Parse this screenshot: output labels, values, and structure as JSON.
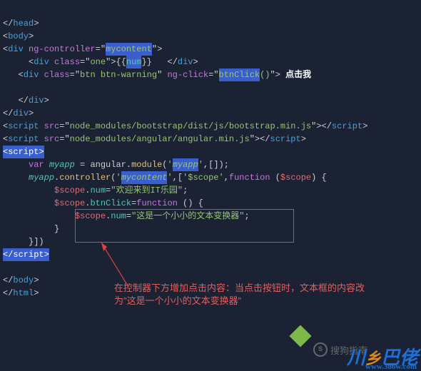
{
  "code": {
    "l1": {
      "close_head": "</",
      "head": "head",
      "gt": ">"
    },
    "l2": {
      "open": "<",
      "body": "body",
      "gt": ">"
    },
    "l3": {
      "open": "<",
      "div": "div",
      "ngctrl": "ng-controller",
      "eq": "=",
      "q": "\"",
      "val": "mycontent",
      "gt": ">"
    },
    "l4": {
      "open": "<",
      "div": "div",
      "class": "class",
      "eq": "=",
      "q": "\"",
      "one": "one",
      "gt": ">",
      "bb1": "{{",
      "num": "num",
      "bb2": "}}",
      "sp": "   ",
      "closeopen": "</",
      "gt2": ">"
    },
    "l5": {
      "open": "<",
      "div": "div",
      "class": "class",
      "eq": "=",
      "q": "\"",
      "btn": "btn btn-warning",
      "ngclick": "ng-click",
      "val": "btnClick",
      "par": "()",
      "gt": ">",
      "txt": " 点击我"
    },
    "l6": "",
    "l7": {
      "closeopen": "</",
      "div": "div",
      "gt": ">"
    },
    "l8": {
      "closeopen": "</",
      "div": "div",
      "gt": ">"
    },
    "l9": {
      "open": "<",
      "script": "script",
      "src": "src",
      "eq": "=",
      "q": "\"",
      "path": "node_modules/bootstrap/dist/js/bootstrap.min.js",
      "gt": ">",
      "close": "</",
      "gt2": ">"
    },
    "l10": {
      "open": "<",
      "script": "script",
      "src": "src",
      "eq": "=",
      "q": "\"",
      "path": "node_modules/angular/angular.min.js",
      "gt": ">",
      "close": "</",
      "gt2": ">"
    },
    "l11": {
      "scripttag": "<script>"
    },
    "l12": {
      "var": "var",
      "myapp": "myapp",
      "eq": " = ",
      "ang": "angular",
      "dot": ".",
      "module": "module",
      "po": "(",
      "q": "'",
      "name": "myapp",
      "comma": ",",
      "arr": "[]",
      "pc": ")",
      "sc": ";"
    },
    "l13": {
      "myapp": "myapp",
      "dot": ".",
      "ctrl": "controller",
      "po": "(",
      "q": "'",
      "name": "mycontent",
      "comma": ",",
      "br": "[",
      "q2": "'",
      "scope": "$scope",
      "comma2": ",",
      "fn": "function",
      "po2": " (",
      "arg": "$scope",
      "pc2": ")",
      "brace": " {"
    },
    "l14": {
      "scope": "$scope",
      "dot": ".",
      "num": "num",
      "eq": "=",
      "q": "\"",
      "txt": "欢迎来到IT乐园",
      "sc": ";"
    },
    "l15": {
      "scope": "$scope",
      "dot": ".",
      "btn": "btnClick",
      "eq": "=",
      "fn": "function",
      "par": " ()",
      "brace": " {"
    },
    "l16": {
      "scope": "$scope",
      "dot": ".",
      "num": "num",
      "eq": "=",
      "q": "\"",
      "txt": "这是一个小小的文本变换器",
      "sc": ";"
    },
    "l17": {
      "brace": "}"
    },
    "l18": {
      "close": "}])"
    },
    "l19": {
      "scriptclose_open": "</",
      "script": "script",
      "gt": ">"
    },
    "l20": "",
    "l21": {
      "close": "</",
      "body": "body",
      "gt": ">"
    },
    "l22": {
      "close": "</",
      "html": "html",
      "gt": ">"
    }
  },
  "annotation": "在控制器下方增加点击内容：当点击按钮时，文本框的内容改为\"这是一个小小的文本变换器\"",
  "watermark1": "搜狗指南",
  "watermark2": {
    "a": "川",
    "b": "乡",
    "c": "巴",
    "d": "佬",
    "url": "www.386w.com"
  }
}
